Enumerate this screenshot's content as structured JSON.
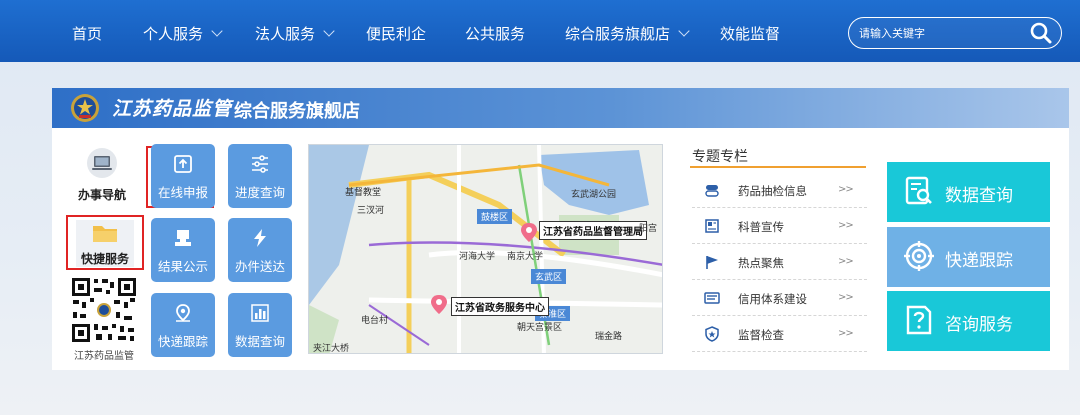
{
  "nav": {
    "items": [
      {
        "label": "首页",
        "dropdown": false
      },
      {
        "label": "个人服务",
        "dropdown": true
      },
      {
        "label": "法人服务",
        "dropdown": true
      },
      {
        "label": "便民利企",
        "dropdown": false
      },
      {
        "label": "公共服务",
        "dropdown": false
      },
      {
        "label": "综合服务旗舰店",
        "dropdown": true
      },
      {
        "label": "效能监督",
        "dropdown": false
      }
    ],
    "search_placeholder": "请输入关键字"
  },
  "header": {
    "brand_calligraphy": "江苏药品监管",
    "title": "综合服务旗舰店"
  },
  "side": {
    "guide_label": "办事导航",
    "quick_label": "快捷服务",
    "qr_caption": "江苏药品监管"
  },
  "tiles": [
    {
      "label": "在线申报",
      "icon": "upload-icon"
    },
    {
      "label": "进度查询",
      "icon": "sliders-icon"
    },
    {
      "label": "结果公示",
      "icon": "stamp-icon"
    },
    {
      "label": "办件送达",
      "icon": "lightning-icon"
    },
    {
      "label": "快递跟踪",
      "icon": "location-icon"
    },
    {
      "label": "数据查询",
      "icon": "bar-chart-icon"
    }
  ],
  "map": {
    "markers": [
      "江苏省药品监督管理局",
      "江苏省政务服务中心"
    ],
    "districts": [
      "鼓楼区",
      "玄武区",
      "秦淮区"
    ],
    "places": [
      "基督教堂",
      "三汊河",
      "玄武湖公园",
      "河海大学",
      "南京大学",
      "电台村",
      "朝天宫景区",
      "瑞金路",
      "夹江大桥",
      "阳宫"
    ]
  },
  "topics": {
    "title": "专题专栏",
    "items": [
      {
        "label": "药品抽检信息",
        "icon": "pill-icon"
      },
      {
        "label": "科普宣传",
        "icon": "newspaper-icon"
      },
      {
        "label": "热点聚焦",
        "icon": "flag-icon"
      },
      {
        "label": "信用体系建设",
        "icon": "id-card-icon"
      },
      {
        "label": "监督检查",
        "icon": "shield-icon"
      }
    ],
    "arrow": ">>"
  },
  "big_buttons": [
    {
      "label": "数据查询",
      "icon": "document-search-icon",
      "color": "#19c8d8"
    },
    {
      "label": "快递跟踪",
      "icon": "target-icon",
      "color": "#6fb1e6"
    },
    {
      "label": "咨询服务",
      "icon": "question-doc-icon",
      "color": "#19c8d8"
    }
  ],
  "colors": {
    "nav_blue": "#1559b8",
    "tile_blue": "#5b9be0",
    "highlight_red": "#e02424",
    "accent_orange": "#f0a030",
    "cyan": "#19c8d8"
  }
}
